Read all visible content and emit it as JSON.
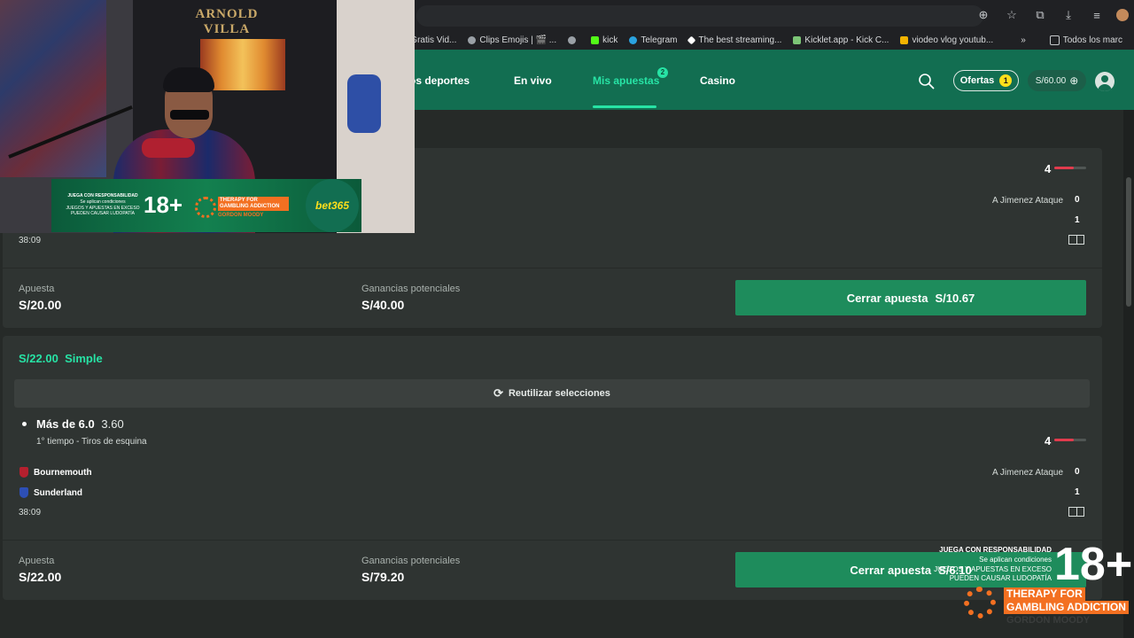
{
  "browser": {
    "bookmarks": [
      {
        "label": "Descarga Gratis Vid...",
        "icon": "doc-icon",
        "color": "#3b6fe0"
      },
      {
        "label": "Clips Emojis | 🎬 ...",
        "icon": "globe-icon",
        "color": "#9aa0a6"
      },
      {
        "label": "",
        "icon": "globe-icon",
        "color": "#9aa0a6"
      },
      {
        "label": "kick",
        "icon": "kick-icon",
        "color": "#53fc18"
      },
      {
        "label": "Telegram",
        "icon": "telegram-icon",
        "color": "#2aa3e0"
      },
      {
        "label": "The best streaming...",
        "icon": "diamond-icon",
        "color": "#ffffff"
      },
      {
        "label": "Kicklet.app - Kick C...",
        "icon": "kicklet-icon",
        "color": "#7cc576"
      },
      {
        "label": "viodeo vlog youtub...",
        "icon": "drive-icon",
        "color": "#f4b400"
      },
      {
        "label": "»",
        "icon": "more-icon",
        "color": "#c5c8cb"
      },
      {
        "label": "Todos los marc",
        "icon": "folder-icon",
        "color": "#c5c8cb"
      }
    ],
    "toolbar_icons": [
      "zoom-icon",
      "star-icon",
      "extensions-icon",
      "download-icon",
      "media-icon"
    ]
  },
  "header": {
    "nav": [
      {
        "label": "os deportes",
        "active": false
      },
      {
        "label": "En vivo",
        "active": false
      },
      {
        "label": "Mis apuestas",
        "active": true,
        "badge": "2"
      },
      {
        "label": "Casino",
        "active": false
      }
    ],
    "ofertas_label": "Ofertas",
    "ofertas_count": "1",
    "balance": "S/60.00",
    "balance_icon": "plus-circle-icon"
  },
  "webcam": {
    "sign": "ARNOLD VILLA",
    "banner": {
      "juega": "JUEGA CON RESPONSABILIDAD",
      "aplican": "Se aplican condiciones",
      "juegos": "JUEGOS Y APUESTAS EN EXCESO PUEDEN CAUSAR LUDOPATÍA",
      "age": "18+",
      "therapy": "THERAPY FOR GAMBLING ADDICTION",
      "gordon": "GORDON MOODY",
      "brand": "bet365"
    }
  },
  "bets": [
    {
      "clock": "38:09",
      "corners": "4",
      "stat_label": "A Jimenez Ataque",
      "score_home": "0",
      "score_away": "1",
      "stake_label": "Apuesta",
      "stake": "S/20.00",
      "potential_label": "Ganancias potenciales",
      "potential": "S/40.00",
      "cashout_label": "Cerrar apuesta",
      "cashout_value": "S/10.67"
    },
    {
      "title_amount": "S/22.00",
      "title_type": "Simple",
      "reuse_label": "Reutilizar selecciones",
      "selection": "Más de 6.0",
      "odds": "3.60",
      "market": "1° tiempo - Tiros de esquina",
      "home_team": "Bournemouth",
      "away_team": "Sunderland",
      "clock": "38:09",
      "corners": "4",
      "stat_label": "A Jimenez Ataque",
      "score_home": "0",
      "score_away": "1",
      "stake_label": "Apuesta",
      "stake": "S/22.00",
      "potential_label": "Ganancias potenciales",
      "potential": "S/79.20",
      "cashout_label": "Cerrar apuesta",
      "cashout_value": "S/6.10"
    }
  ],
  "overlay": {
    "juega": "JUEGA CON RESPONSABILIDAD",
    "aplican": "Se aplican condiciones",
    "juegos1": "JUEGOS Y APUESTAS EN EXCESO",
    "juegos2": "PUEDEN CAUSAR LUDOPATÍA",
    "age": "18+",
    "therapy1": "THERAPY FOR",
    "therapy2": "GAMBLING ADDICTION",
    "gordon": "GORDON MOODY"
  },
  "colors": {
    "header_green": "#126e51",
    "accent": "#27e3a5",
    "cashout_green": "#1e8c5c",
    "offer_yellow": "#ffdf1b",
    "rg_orange": "#f37021"
  }
}
